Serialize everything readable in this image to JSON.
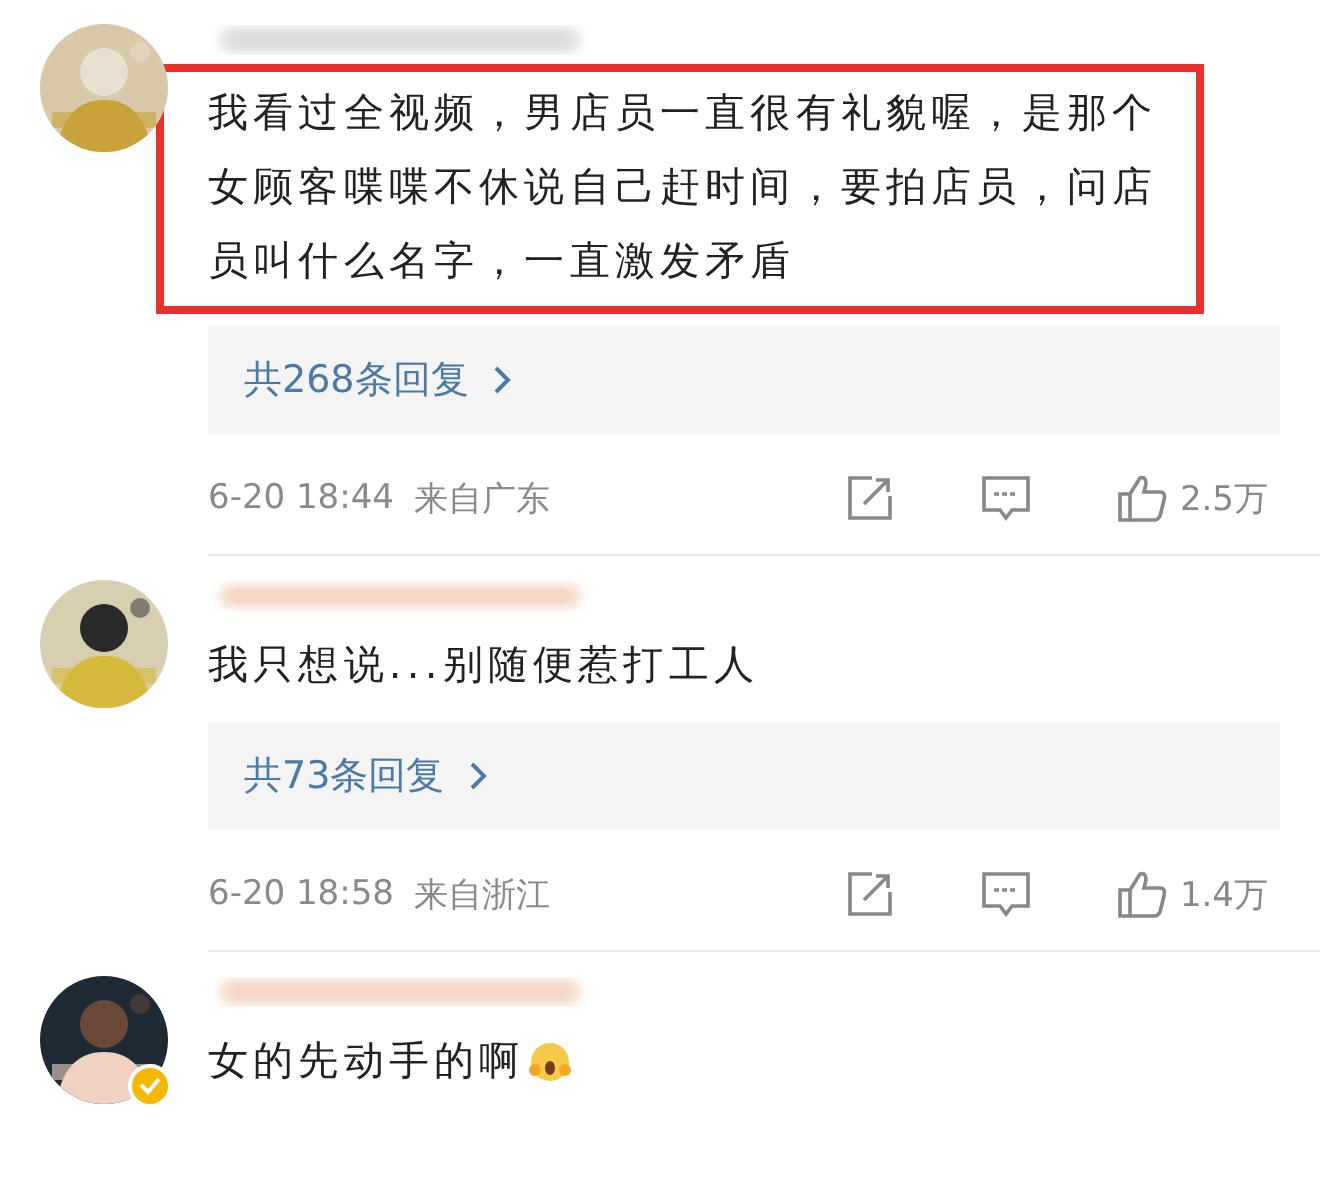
{
  "comments": [
    {
      "verified": false,
      "highlighted": true,
      "text": "我看过全视频，男店员一直很有礼貌喔，是那个女顾客喋喋不休说自己赶时间，要拍店员，问店员叫什么名字，一直激发矛盾",
      "replies": "共268条回复",
      "time": "6-20 18:44",
      "location": "来自广东",
      "likes": "2.5万",
      "emoji": false
    },
    {
      "verified": false,
      "highlighted": false,
      "text": "我只想说...别随便惹打工人",
      "replies": "共73条回复",
      "time": "6-20 18:58",
      "location": "来自浙江",
      "likes": "1.4万",
      "emoji": false
    },
    {
      "verified": true,
      "highlighted": false,
      "text": "女的先动手的啊",
      "emoji": true
    }
  ]
}
